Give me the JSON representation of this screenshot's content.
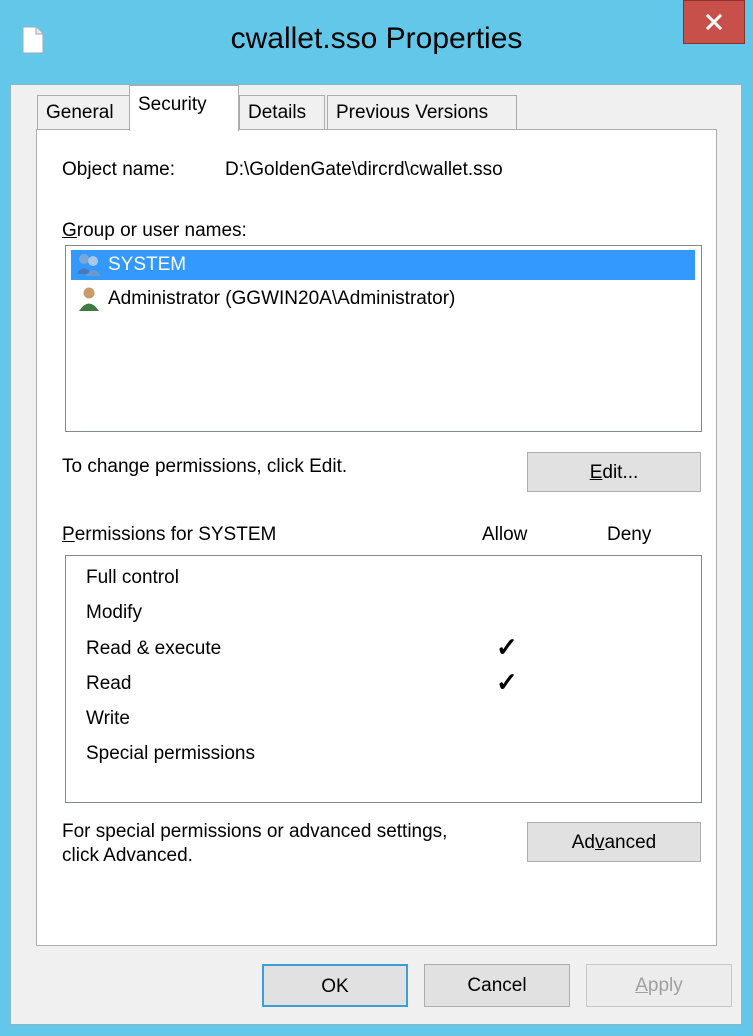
{
  "window": {
    "title": "cwallet.sso Properties",
    "close_glyph": "✕"
  },
  "tabs": [
    {
      "label": "General"
    },
    {
      "label": "Security"
    },
    {
      "label": "Details"
    },
    {
      "label": "Previous Versions"
    }
  ],
  "security": {
    "object_name_label": "Object name:",
    "object_name_value": "D:\\GoldenGate\\dircrd\\cwallet.sso",
    "group_label": "Group or user names:",
    "users": [
      {
        "name": "SYSTEM",
        "icon": "user-group-icon",
        "selected": true
      },
      {
        "name": "Administrator (GGWIN20A\\Administrator)",
        "icon": "user-icon",
        "selected": false
      }
    ],
    "change_hint": "To change permissions, click Edit.",
    "edit_button": "Edit...",
    "permissions_label": "Permissions for SYSTEM",
    "allow_header": "Allow",
    "deny_header": "Deny",
    "permissions": [
      {
        "name": "Full control",
        "allow": false,
        "deny": false
      },
      {
        "name": "Modify",
        "allow": false,
        "deny": false
      },
      {
        "name": "Read & execute",
        "allow": true,
        "deny": false
      },
      {
        "name": "Read",
        "allow": true,
        "deny": false
      },
      {
        "name": "Write",
        "allow": false,
        "deny": false
      },
      {
        "name": "Special permissions",
        "allow": false,
        "deny": false
      }
    ],
    "check_glyph": "✓",
    "advanced_hint_line1": "For special permissions or advanced settings,",
    "advanced_hint_line2": "click Advanced.",
    "advanced_button": "Advanced"
  },
  "footer": {
    "ok": "OK",
    "cancel": "Cancel",
    "apply": "Apply"
  },
  "colors": {
    "titlebar": "#62c7e8",
    "close": "#c7504a",
    "selection": "#3399ff"
  }
}
